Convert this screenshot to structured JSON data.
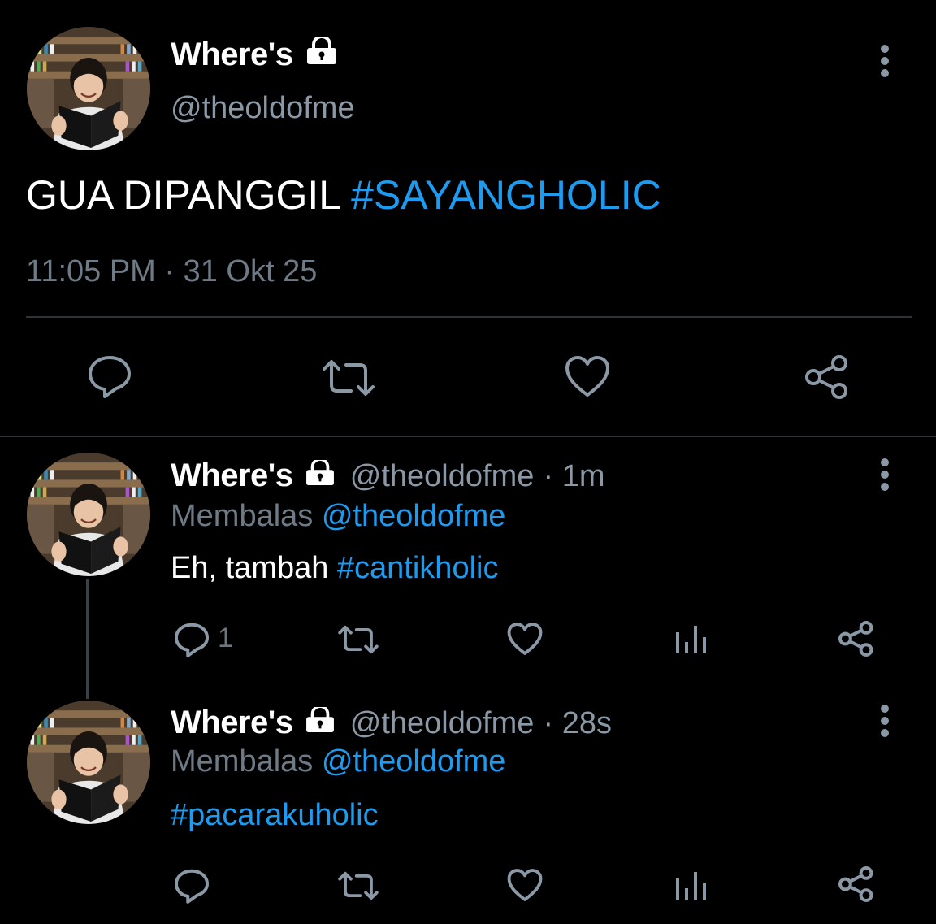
{
  "main_tweet": {
    "display_name": "Where's",
    "handle": "@theoldofme",
    "text_plain": "GUA DIPANGGIL ",
    "text_hashtag": "#SAYANGHOLIC",
    "timestamp": "11:05 PM · 31 Okt 25"
  },
  "replies": [
    {
      "display_name": "Where's",
      "handle": "@theoldofme",
      "time": "· 1m",
      "replying_label": "Membalas ",
      "replying_to": "@theoldofme",
      "text_plain": "Eh, tambah ",
      "text_hashtag": "#cantikholic",
      "reply_count": "1"
    },
    {
      "display_name": "Where's",
      "handle": "@theoldofme",
      "time": "· 28s",
      "replying_label": "Membalas ",
      "replying_to": "@theoldofme",
      "text_plain": "",
      "text_hashtag": "#pacarakuholic",
      "reply_count": ""
    }
  ],
  "icons": {
    "verified_lock": "lock-icon",
    "more": "more-vertical-icon",
    "reply": "comment-icon",
    "retweet": "retweet-icon",
    "like": "heart-icon",
    "analytics": "analytics-icon",
    "share": "share-icon"
  },
  "colors": {
    "background": "#000000",
    "link": "#1d9bf0",
    "secondary_text": "#8b98a5",
    "icon": "#8b98a5",
    "divider": "#2f3336"
  }
}
